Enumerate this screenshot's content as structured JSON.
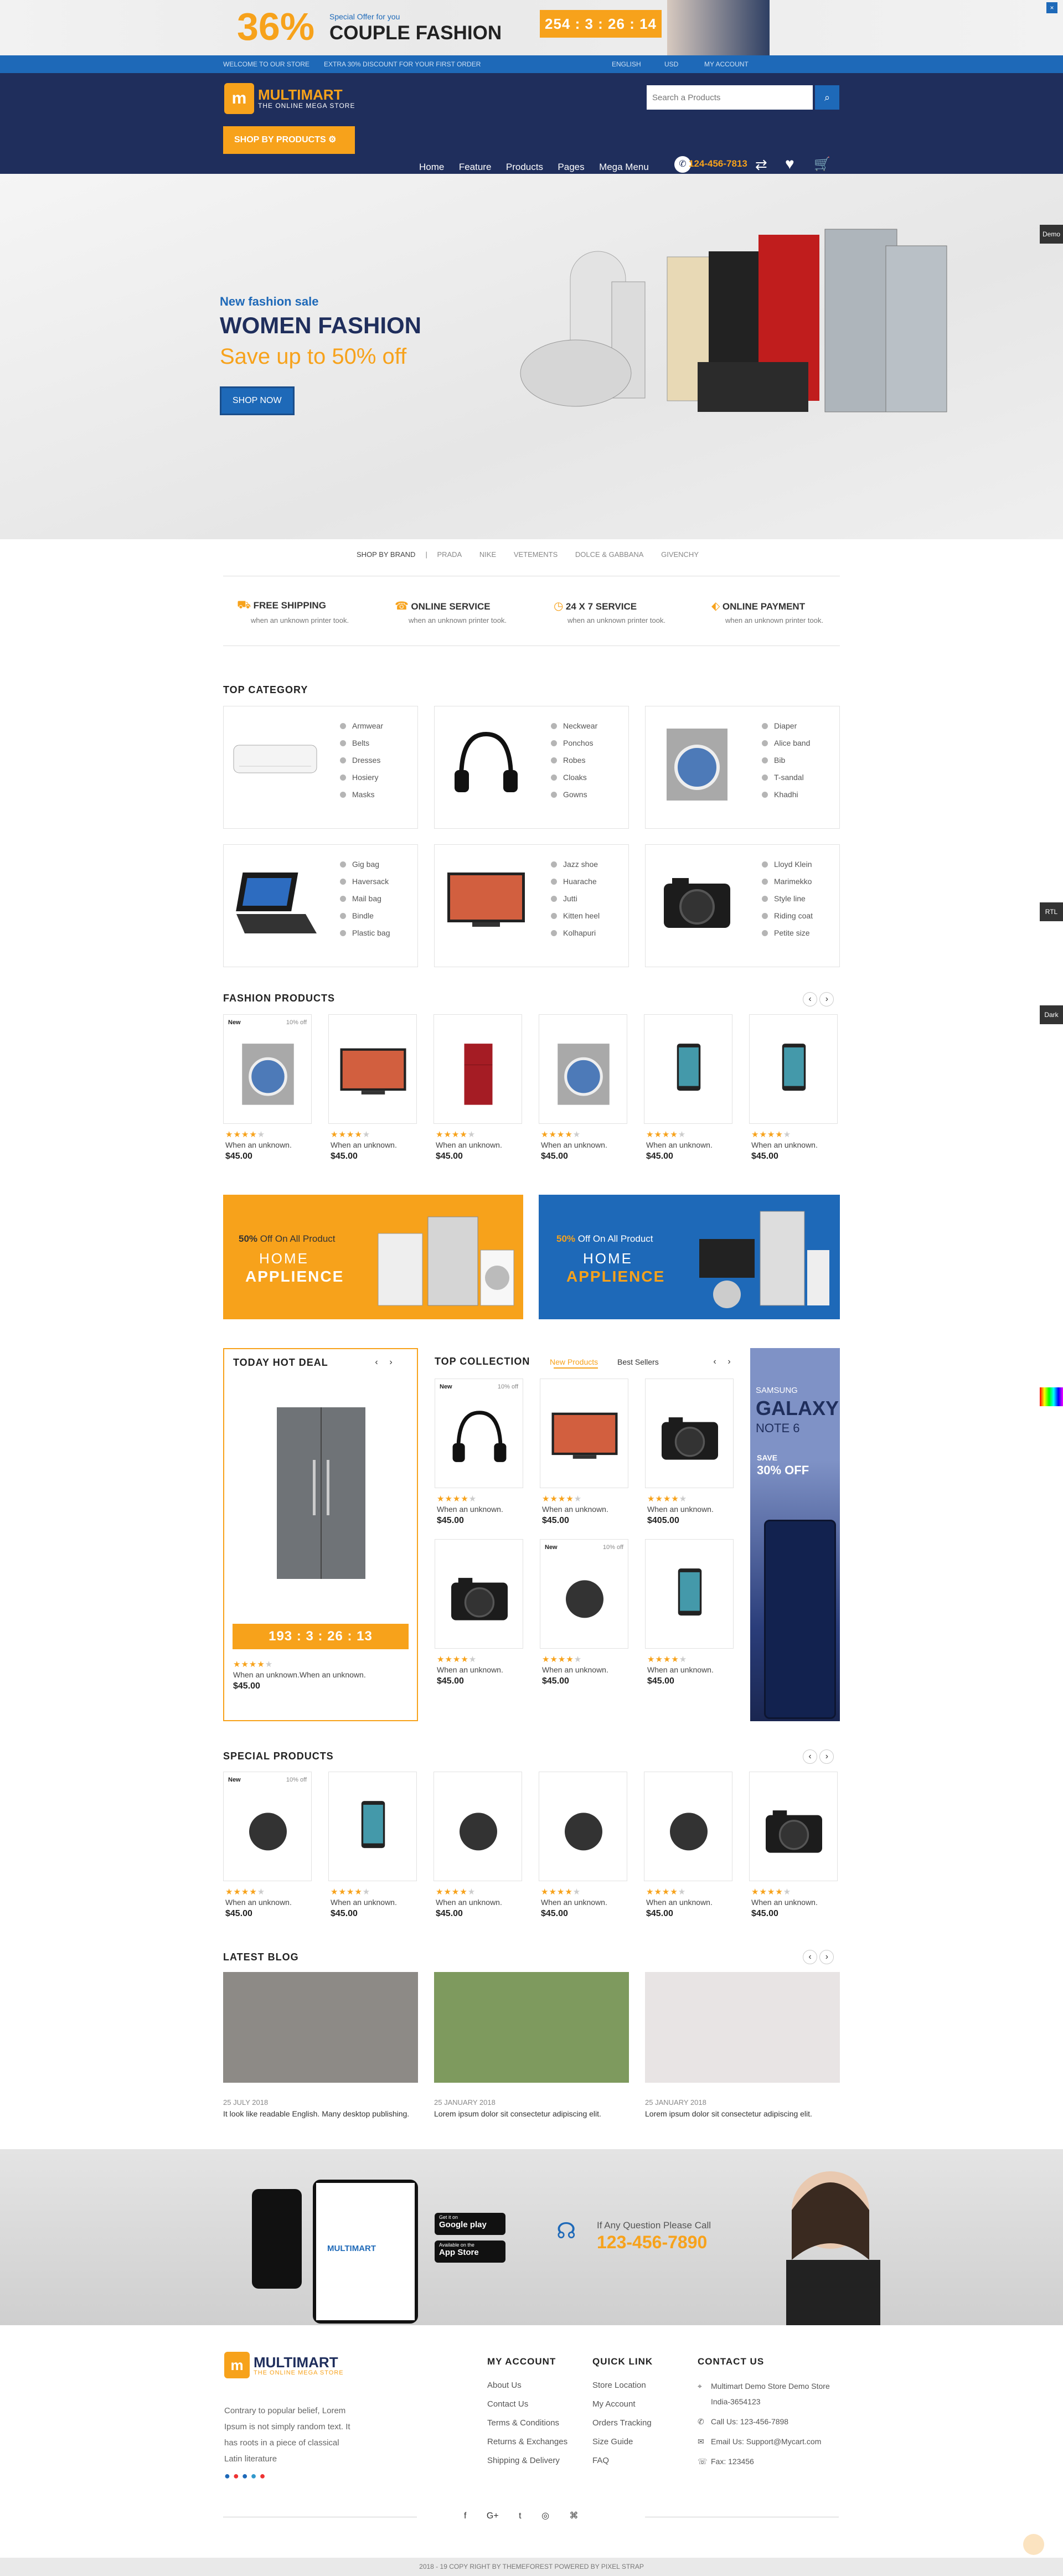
{
  "promo": {
    "percent": "36%",
    "offer": "Special Offer for you",
    "title": "COUPLE FASHION",
    "timer": "254 : 3 : 26 : 14"
  },
  "topbar": {
    "welcome": "WELCOME TO OUR STORE",
    "discount": "EXTRA 30% DISCOUNT FOR YOUR FIRST ORDER",
    "lang": "ENGLISH",
    "currency": "USD",
    "account": "MY ACCOUNT"
  },
  "header": {
    "logo": "MULTIMART",
    "tagline": "THE ONLINE MEGA STORE",
    "search_placeholder": "Search a Products",
    "shop_by": "SHOP BY PRODUCTS",
    "phone": "124-456-7813",
    "nav": [
      "Home",
      "Feature",
      "Products",
      "Pages",
      "Mega Menu"
    ]
  },
  "hero": {
    "sub": "New fashion sale",
    "title": "WOMEN FASHION",
    "offer": "Save up to 50% off",
    "button": "SHOP NOW"
  },
  "brands": {
    "label": "SHOP BY BRAND",
    "items": [
      "PRADA",
      "NIKE",
      "VETEMENTS",
      "DOLCE & GABBANA",
      "GIVENCHY"
    ]
  },
  "services": [
    {
      "title": "FREE SHIPPING",
      "desc": "when an unknown printer took."
    },
    {
      "title": "ONLINE SERVICE",
      "desc": "when an unknown printer took."
    },
    {
      "title": "24 X 7 SERVICE",
      "desc": "when an unknown printer took."
    },
    {
      "title": "ONLINE PAYMENT",
      "desc": "when an unknown printer took."
    }
  ],
  "top_category": {
    "title": "TOP CATEGORY",
    "cards": [
      {
        "icon": "air-conditioner",
        "items": [
          "Armwear",
          "Belts",
          "Dresses",
          "Hosiery",
          "Masks"
        ]
      },
      {
        "icon": "headphones",
        "items": [
          "Neckwear",
          "Ponchos",
          "Robes",
          "Cloaks",
          "Gowns"
        ]
      },
      {
        "icon": "washing-machine",
        "items": [
          "Diaper",
          "Alice band",
          "Bib",
          "T-sandal",
          "Khadhi"
        ]
      },
      {
        "icon": "laptop",
        "items": [
          "Gig bag",
          "Haversack",
          "Mail bag",
          "Bindle",
          "Plastic bag"
        ]
      },
      {
        "icon": "television",
        "items": [
          "Jazz shoe",
          "Huarache",
          "Jutti",
          "Kitten heel",
          "Kolhapuri"
        ]
      },
      {
        "icon": "camera",
        "items": [
          "Lloyd Klein",
          "Marimekko",
          "Style line",
          "Riding coat",
          "Petite size"
        ]
      }
    ]
  },
  "fashion": {
    "title": "FASHION PRODUCTS",
    "new": "New",
    "off": "10% off",
    "products": [
      {
        "icon": "washing-machine",
        "name": "When an unknown.",
        "price": "$45.00"
      },
      {
        "icon": "television",
        "name": "When an unknown.",
        "price": "$45.00"
      },
      {
        "icon": "refrigerator",
        "name": "When an unknown.",
        "price": "$45.00"
      },
      {
        "icon": "washing-machine",
        "name": "When an unknown.",
        "price": "$45.00"
      },
      {
        "icon": "smartphone",
        "name": "When an unknown.",
        "price": "$45.00"
      },
      {
        "icon": "smartphone",
        "name": "When an unknown.",
        "price": "$45.00"
      }
    ]
  },
  "banners": [
    {
      "pct": "50%",
      "pct_text": "Off On All Product",
      "line1": "HOME",
      "line2": "APPLIENCE",
      "color": "#f7a21b"
    },
    {
      "pct": "50%",
      "pct_text": "Off On All Product",
      "line1": "HOME",
      "line2": "APPLIENCE",
      "color": "#1e69b8"
    }
  ],
  "hot_deal": {
    "title": "TODAY HOT DEAL",
    "timer": "193 : 3 : 26 : 13",
    "name": "When an unknown.When an unknown.",
    "price": "$45.00"
  },
  "collection": {
    "title": "TOP COLLECTION",
    "tab1": "New Products",
    "tab2": "Best Sellers",
    "new": "New",
    "off": "10% off",
    "products": [
      {
        "name": "When an unknown.",
        "price": "$45.00"
      },
      {
        "name": "When an unknown.",
        "price": "$45.00"
      },
      {
        "name": "When an unknown.",
        "price": "$405.00"
      },
      {
        "name": "When an unknown.",
        "price": "$45.00"
      },
      {
        "name": "When an unknown.",
        "price": "$45.00"
      },
      {
        "name": "When an unknown.",
        "price": "$45.00"
      }
    ]
  },
  "galaxy": {
    "brand": "SAMSUNG",
    "title": "GALAXY",
    "model": "NOTE 6",
    "save": "SAVE",
    "off": "30% OFF"
  },
  "special": {
    "title": "SPECIAL PRODUCTS",
    "new": "New",
    "off": "10% off",
    "products": [
      {
        "name": "When an unknown.",
        "price": "$45.00"
      },
      {
        "name": "When an unknown.",
        "price": "$45.00"
      },
      {
        "name": "When an unknown.",
        "price": "$45.00"
      },
      {
        "name": "When an unknown.",
        "price": "$45.00"
      },
      {
        "name": "When an unknown.",
        "price": "$45.00"
      },
      {
        "name": "When an unknown.",
        "price": "$45.00"
      }
    ]
  },
  "blog": {
    "title": "LATEST BLOG",
    "posts": [
      {
        "date": "25 JULY 2018",
        "text": "It look like readable English. Many desktop publishing.",
        "color": "#8d8a86"
      },
      {
        "date": "25 JANUARY 2018",
        "text": "Lorem ipsum dolor sit consectetur adipiscing elit.",
        "color": "#7e9a5e"
      },
      {
        "date": "25 JANUARY 2018",
        "text": "Lorem ipsum dolor sit consectetur adipiscing elit.",
        "color": "#e8e4e4"
      }
    ]
  },
  "app": {
    "google": "Google play",
    "apple": "App Store",
    "google_small": "Get it on",
    "apple_small": "Available on the",
    "question": "If Any Question Please Call",
    "phone": "123-456-7890",
    "app_logo": "MULTIMART"
  },
  "footer": {
    "about": "Contrary to popular belief, Lorem Ipsum is not simply random text. It has roots in a piece of classical Latin literature",
    "account_title": "MY ACCOUNT",
    "account": [
      "About Us",
      "Contact Us",
      "Terms & Conditions",
      "Returns & Exchanges",
      "Shipping & Delivery"
    ],
    "quick_title": "QUICK LINK",
    "quick": [
      "Store Location",
      "My Account",
      "Orders Tracking",
      "Size Guide",
      "FAQ"
    ],
    "contact_title": "CONTACT US",
    "address": "Multimart Demo Store Demo Store India-3654123",
    "call": "Call Us: 123-456-7898",
    "email": "Email Us: Support@Mycart.com",
    "fax": "Fax: 123456",
    "social": [
      "f",
      "G+",
      "t",
      "◎",
      "⌘"
    ],
    "copyright": "2018 - 19 COPY RIGHT BY THEMEFOREST POWERED BY PIXEL STRAP"
  },
  "side": {
    "demo": "Demo",
    "rtl": "RTL",
    "dark": "Dark"
  },
  "colors": {
    "accent": "#f7a21b",
    "primary": "#1e69b8",
    "navy": "#1f2e5c"
  }
}
